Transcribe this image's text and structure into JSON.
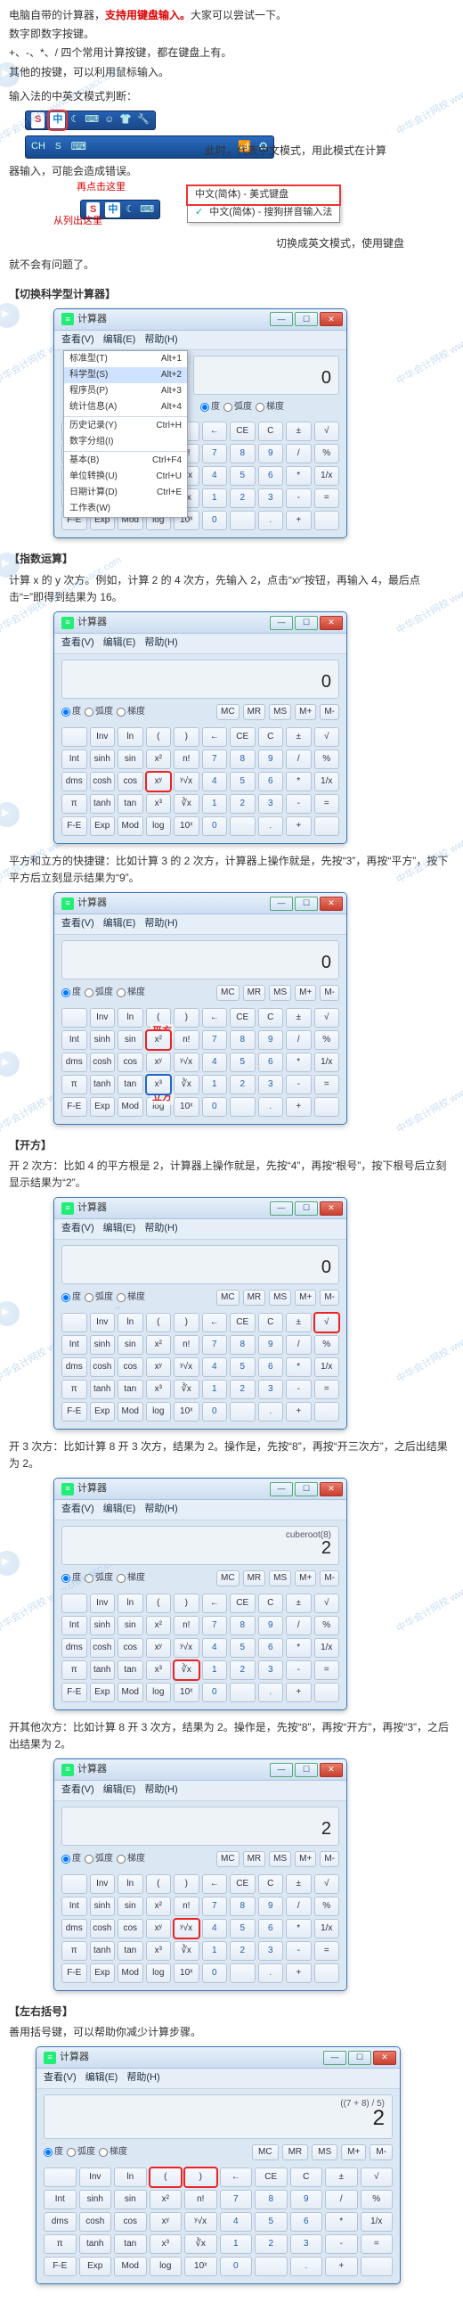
{
  "intro": {
    "p1a": "电脑自带的计算器，",
    "p1b": "支持用键盘输入。",
    "p1c": "大家可以尝试一下。",
    "p2": "数字即数字按键。",
    "p3": "+、-、*、/ 四个常用计算按键，都在键盘上有。",
    "p4": "其他的按键，可以利用鼠标输入。",
    "p5": "输入法的中英文模式判断：",
    "p6a": "此时，代表中文模式，用此模式在计算",
    "p6b": "器输入，可能会造成错误。",
    "arrow_top": "再点击这里",
    "arrow_bot": "从列出这里",
    "popup1": "中文(简体) - 美式键盘",
    "popup2": "中文(简体) - 搜狗拼音输入法",
    "p7a": "切换成英文模式，使用键盘",
    "p7b": "就不会有问题了。"
  },
  "ime": {
    "zh": "中",
    "s": "S",
    "ch": "CH",
    "ic_moon": "☾",
    "ic_key": "⌨",
    "ic_face": "☺",
    "ic_shirt": "👕",
    "ic_wrench": "🔧",
    "ic_wifi": "📶",
    "ic_set": "⚙"
  },
  "sec1": {
    "title": "【切换科学型计算器】",
    "menu": [
      [
        "标准型(T)",
        "Alt+1"
      ],
      [
        "科学型(S)",
        "Alt+2"
      ],
      [
        "程序员(P)",
        "Alt+3"
      ],
      [
        "统计信息(A)",
        "Alt+4"
      ],
      [
        "",
        ""
      ],
      [
        "历史记录(Y)",
        "Ctrl+H"
      ],
      [
        "数字分组(I)",
        ""
      ],
      [
        "",
        ""
      ],
      [
        "基本(B)",
        "Ctrl+F4"
      ],
      [
        "单位转换(U)",
        "Ctrl+U"
      ],
      [
        "日期计算(D)",
        "Ctrl+E"
      ],
      [
        "工作表(W)",
        ""
      ]
    ]
  },
  "sec2": {
    "title": "【指数运算】",
    "p1": "计算 x 的 y 次方。例如，计算 2 的 4 次方，先输入 2，点击“xʸ”按钮，再输入 4，最后点击“=”即得到结果为 16。",
    "p2": "平方和立方的快捷键：比如计算 3 的 2 次方，计算器上操作就是，先按“3”，再按“平方”，按下平方后立刻显示结果为“9”。",
    "anno_sq": "平方",
    "anno_cb": "立方"
  },
  "sec3": {
    "title": "【开方】",
    "p1": "开 2 次方：比如 4 的平方根是 2，计算器上操作就是，先按“4”，再按“根号”，按下根号后立刻显示结果为“2”。",
    "p2": "开 3 次方：比如计算 8 开 3 次方，结果为 2。操作是，先按“8”，再按“开三次方”，之后出结果为 2。",
    "p3": "开其他次方：比如计算 8 开 3 次方，结果为 2。操作是，先按“8”，再按“开方”，再按“3”，之后出结果为 2。",
    "expr_cuberoot": "cuberoot(8)"
  },
  "sec4": {
    "title": "【左右括号】",
    "p1": "善用括号键，可以帮助你减少计算步骤。",
    "expr": "((7 + 8) / 5)"
  },
  "calc": {
    "title": "计算器",
    "menu_view": "查看(V)",
    "menu_edit": "编辑(E)",
    "menu_help": "帮助(H)",
    "val0": "0",
    "val2": "2",
    "mode_deg": "度",
    "mode_rad": "弧度",
    "mode_grad": "梯度",
    "mem": [
      "MC",
      "MR",
      "MS",
      "M+",
      "M-"
    ],
    "top": [
      "←",
      "CE",
      "C",
      "±",
      "√"
    ],
    "row_sci_1": [
      "",
      "Inv",
      "ln",
      "(",
      ")"
    ],
    "row_num_1": [
      "7",
      "8",
      "9",
      "/",
      "%"
    ],
    "row_sci_2": [
      "Int",
      "sinh",
      "sin",
      "x²",
      "n!"
    ],
    "row_num_2": [
      "4",
      "5",
      "6",
      "*",
      "1/x"
    ],
    "row_sci_3": [
      "dms",
      "cosh",
      "cos",
      "xʸ",
      "ʸ√x"
    ],
    "row_num_3": [
      "1",
      "2",
      "3",
      "-",
      "="
    ],
    "row_sci_4": [
      "π",
      "tanh",
      "tan",
      "x³",
      "∛x"
    ],
    "row_num_4": [
      "0",
      "",
      ".",
      "+",
      ""
    ],
    "row_sci_5": [
      "F-E",
      "Exp",
      "Mod",
      "log",
      "10ˣ"
    ]
  },
  "watermark": "中华会计网校 www.chinaacc.com"
}
